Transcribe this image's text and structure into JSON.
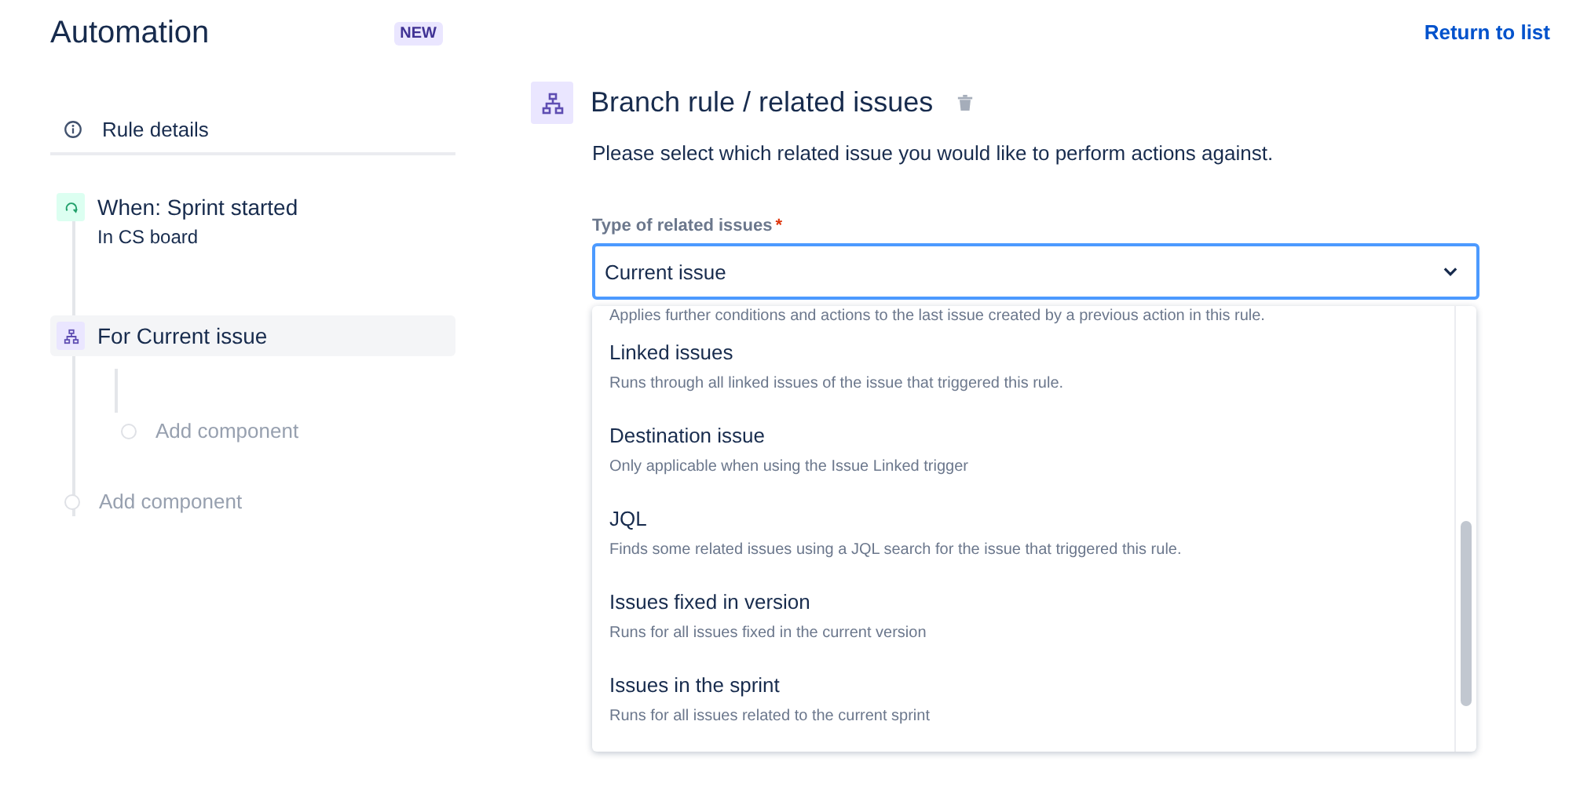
{
  "header": {
    "title": "Automation",
    "badge": "NEW",
    "link": "Return to list"
  },
  "sidebar": {
    "details": "Rule details",
    "components": [
      {
        "kind": "trigger",
        "title": "When: Sprint started",
        "subtitle": "In CS board",
        "selected": false
      },
      {
        "kind": "branch",
        "title": "For Current issue",
        "selected": true,
        "children": [
          {
            "kind": "add",
            "title": "Add component",
            "selected": false
          }
        ]
      },
      {
        "kind": "add",
        "title": "Add component",
        "selected": false
      }
    ]
  },
  "panel": {
    "title": "Branch rule / related issues",
    "description": "Please select which related issue you would like to perform actions against.",
    "field": {
      "label": "Type of related issues",
      "required_mark": "*",
      "value": "Current issue"
    },
    "options": [
      {
        "description": "Applies further conditions and actions to the last issue created by a previous action in this rule."
      },
      {
        "title": "Linked issues",
        "description": "Runs through all linked issues of the issue that triggered this rule."
      },
      {
        "title": "Destination issue",
        "description": "Only applicable when using the Issue Linked trigger"
      },
      {
        "title": "JQL",
        "description": "Finds some related issues using a JQL search for the issue that triggered this rule."
      },
      {
        "title": "Issues fixed in version",
        "description": "Runs for all issues fixed in the current version"
      },
      {
        "title": "Issues in the sprint",
        "description": "Runs for all issues related to the current sprint"
      }
    ]
  }
}
